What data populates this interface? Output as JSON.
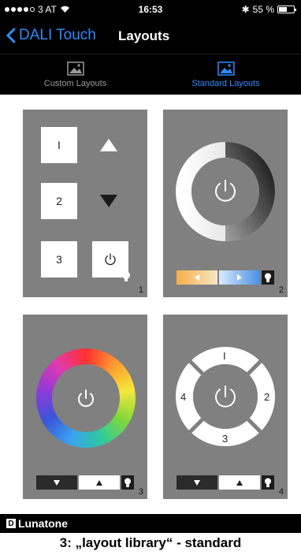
{
  "status": {
    "carrier": "3 AT",
    "time": "16:53",
    "bluetooth": "✱",
    "battery": "55 %",
    "battery_level": 0.55
  },
  "nav": {
    "back_label": "DALI Touch",
    "title": "Layouts"
  },
  "tabs": [
    {
      "label": "Custom Layouts",
      "icon": "image-icon",
      "active": false
    },
    {
      "label": "Standard Layouts",
      "icon": "image-icon",
      "active": true
    }
  ],
  "layouts": [
    {
      "number": "1",
      "buttons": [
        "I",
        "2",
        "3"
      ]
    },
    {
      "number": "2"
    },
    {
      "number": "3"
    },
    {
      "number": "4",
      "ring_labels": [
        "I",
        "2",
        "3",
        "4"
      ]
    }
  ],
  "footer": {
    "brand_mark": "D",
    "brand": "Lunatone",
    "caption": "3: „layout library“ - standard"
  },
  "colors": {
    "accent": "#2f8cff",
    "card": "#808080",
    "bar": "#000000"
  }
}
